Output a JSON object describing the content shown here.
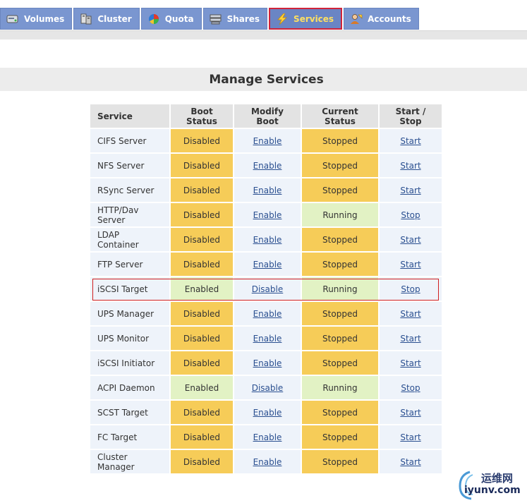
{
  "tabs": [
    {
      "label": "Volumes",
      "icon": "volumes-icon"
    },
    {
      "label": "Cluster",
      "icon": "cluster-icon"
    },
    {
      "label": "Quota",
      "icon": "quota-icon"
    },
    {
      "label": "Shares",
      "icon": "shares-icon"
    },
    {
      "label": "Services",
      "icon": "lightning-icon",
      "active": true
    },
    {
      "label": "Accounts",
      "icon": "accounts-icon"
    }
  ],
  "page": {
    "title": "Manage Services"
  },
  "table": {
    "headers": [
      "Service",
      "Boot Status",
      "Modify Boot",
      "Current Status",
      "Start / Stop"
    ],
    "rows": [
      {
        "service": "CIFS Server",
        "boot": "Disabled",
        "modify": "Enable",
        "current": "Stopped",
        "action": "Start"
      },
      {
        "service": "NFS Server",
        "boot": "Disabled",
        "modify": "Enable",
        "current": "Stopped",
        "action": "Start"
      },
      {
        "service": "RSync Server",
        "boot": "Disabled",
        "modify": "Enable",
        "current": "Stopped",
        "action": "Start"
      },
      {
        "service": "HTTP/Dav Server",
        "boot": "Disabled",
        "modify": "Enable",
        "current": "Running",
        "action": "Stop"
      },
      {
        "service": "LDAP Container",
        "boot": "Disabled",
        "modify": "Enable",
        "current": "Stopped",
        "action": "Start"
      },
      {
        "service": "FTP Server",
        "boot": "Disabled",
        "modify": "Enable",
        "current": "Stopped",
        "action": "Start"
      },
      {
        "service": "iSCSI Target",
        "boot": "Enabled",
        "modify": "Disable",
        "current": "Running",
        "action": "Stop",
        "highlighted": true
      },
      {
        "service": "UPS Manager",
        "boot": "Disabled",
        "modify": "Enable",
        "current": "Stopped",
        "action": "Start"
      },
      {
        "service": "UPS Monitor",
        "boot": "Disabled",
        "modify": "Enable",
        "current": "Stopped",
        "action": "Start"
      },
      {
        "service": "iSCSI Initiator",
        "boot": "Disabled",
        "modify": "Enable",
        "current": "Stopped",
        "action": "Start"
      },
      {
        "service": "ACPI Daemon",
        "boot": "Enabled",
        "modify": "Disable",
        "current": "Running",
        "action": "Stop"
      },
      {
        "service": "SCST Target",
        "boot": "Disabled",
        "modify": "Enable",
        "current": "Stopped",
        "action": "Start"
      },
      {
        "service": "FC Target",
        "boot": "Disabled",
        "modify": "Enable",
        "current": "Stopped",
        "action": "Start"
      },
      {
        "service": "Cluster Manager",
        "boot": "Disabled",
        "modify": "Enable",
        "current": "Stopped",
        "action": "Start"
      }
    ]
  },
  "watermark": {
    "cn": "运维网",
    "url": "iyunv.com"
  },
  "colors": {
    "tab_bg": "#7a96d0",
    "active_border": "#d0243a",
    "disabled_bg": "#f6cc58",
    "enabled_bg": "#e2f2c4",
    "link": "#2a4f90",
    "highlight_border": "#d02020"
  }
}
